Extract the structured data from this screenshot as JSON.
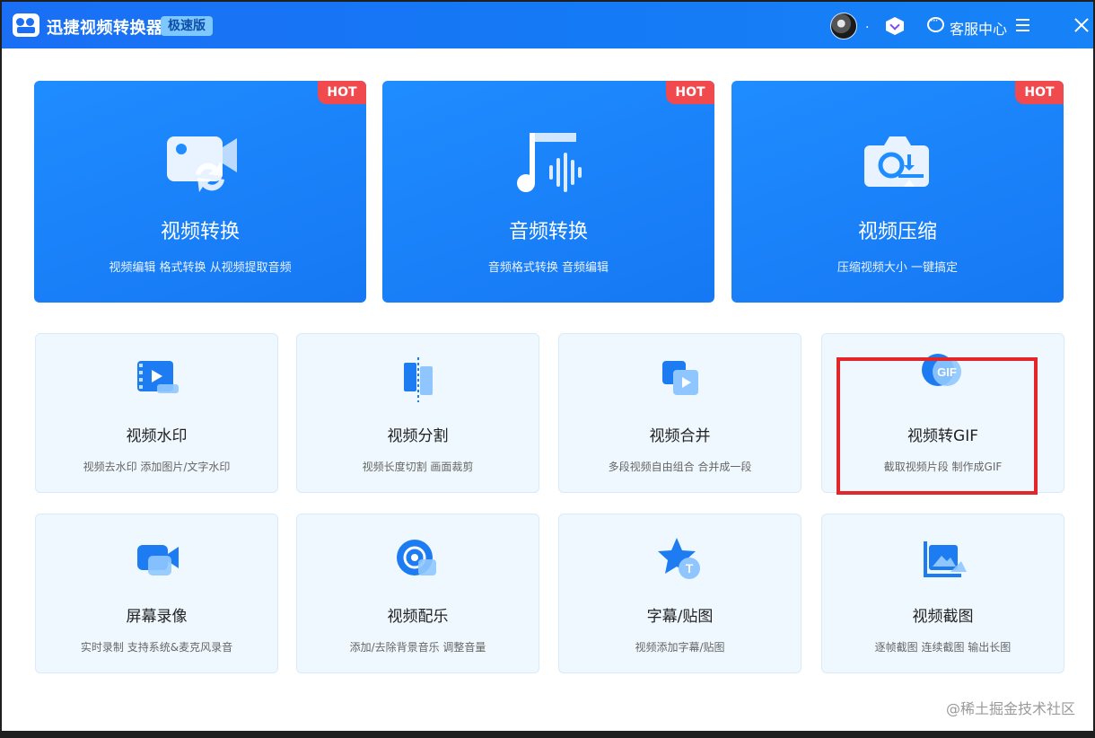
{
  "app": {
    "title": "迅捷视频转换器",
    "edition": "极速版",
    "username": ".",
    "service_label": "客服中心"
  },
  "colors": {
    "accent": "#1a6ff5",
    "hot": "#f04a4e",
    "card_bg": "#eff8ff",
    "highlight": "#e2262a"
  },
  "big_cards": [
    {
      "title": "视频转换",
      "desc": "视频编辑 格式转换 从视频提取音频",
      "badge": "HOT",
      "icon": "video-convert-icon"
    },
    {
      "title": "音频转换",
      "desc": "音频格式转换 音频编辑",
      "badge": "HOT",
      "icon": "audio-convert-icon"
    },
    {
      "title": "视频压缩",
      "desc": "压缩视频大小 一键搞定",
      "badge": "HOT",
      "icon": "video-compress-icon"
    }
  ],
  "small_cards": [
    {
      "title": "视频水印",
      "desc": "视频去水印 添加图片/文字水印",
      "icon": "watermark-icon"
    },
    {
      "title": "视频分割",
      "desc": "视频长度切割 画面裁剪",
      "icon": "split-icon"
    },
    {
      "title": "视频合并",
      "desc": "多段视频自由组合 合并成一段",
      "icon": "merge-icon"
    },
    {
      "title": "视频转GIF",
      "desc": "截取视频片段 制作成GIF",
      "icon": "gif-icon",
      "gif_label": "GIF"
    },
    {
      "title": "屏幕录像",
      "desc": "实时录制 支持系统&麦克风录音",
      "icon": "screen-record-icon"
    },
    {
      "title": "视频配乐",
      "desc": "添加/去除背景音乐 调整音量",
      "icon": "music-icon"
    },
    {
      "title": "字幕/贴图",
      "desc": "视频添加字幕/贴图",
      "icon": "subtitle-icon",
      "glyph": "T"
    },
    {
      "title": "视频截图",
      "desc": "逐帧截图 连续截图 输出长图",
      "icon": "screenshot-icon"
    }
  ],
  "watermark": "@稀土掘金技术社区"
}
